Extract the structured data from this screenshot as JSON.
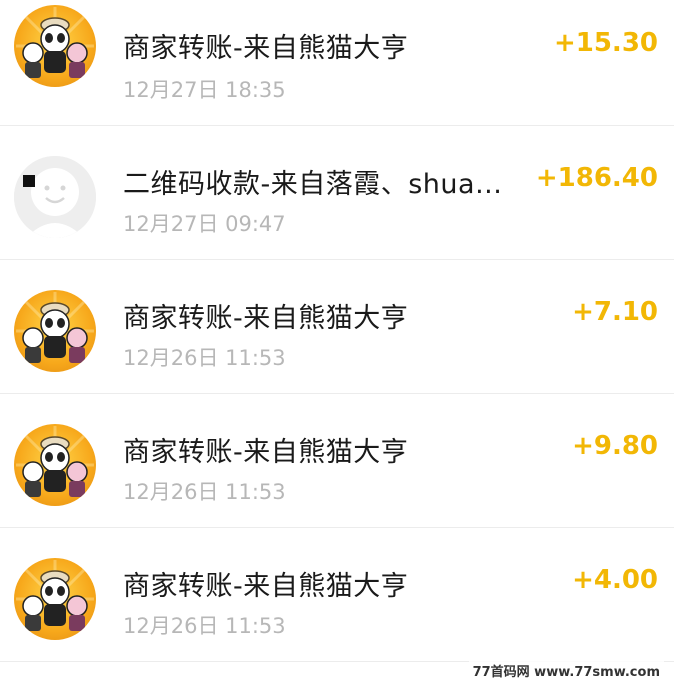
{
  "transactions": [
    {
      "title": "商家转账-来自熊猫大亨",
      "time": "12月27日 18:35",
      "amount": "+15.30",
      "avatar": "panda-group"
    },
    {
      "title": "二维码收款-来自落霞、shua...",
      "time": "12月27日 09:47",
      "amount": "+186.40",
      "avatar": "default-face"
    },
    {
      "title": "商家转账-来自熊猫大亨",
      "time": "12月26日 11:53",
      "amount": "+7.10",
      "avatar": "panda-group"
    },
    {
      "title": "商家转账-来自熊猫大亨",
      "time": "12月26日 11:53",
      "amount": "+9.80",
      "avatar": "panda-group"
    },
    {
      "title": "商家转账-来自熊猫大亨",
      "time": "12月26日 11:53",
      "amount": "+4.00",
      "avatar": "panda-group"
    }
  ],
  "watermark": "77首码网 www.77smw.com",
  "colors": {
    "amount": "#f2b705",
    "title": "#1a1a1a",
    "time": "#b7b7b7"
  }
}
